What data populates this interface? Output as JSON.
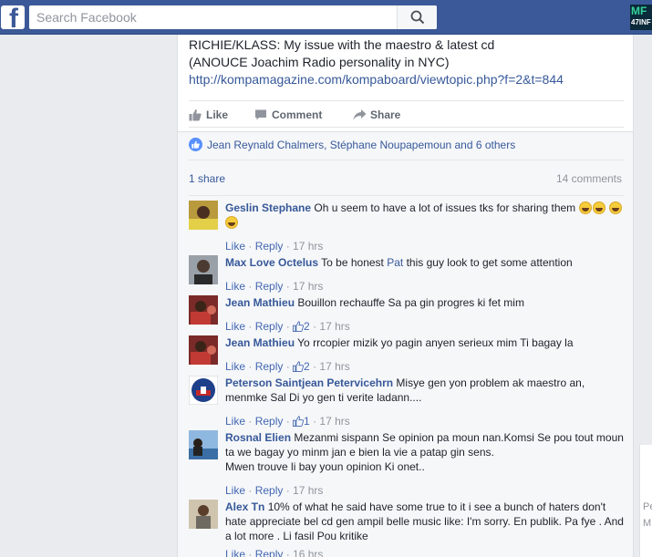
{
  "topbar": {
    "logo_letter": "f",
    "search_placeholder": "Search Facebook",
    "corner_logo_line1": "MF",
    "corner_logo_line2": "47INF"
  },
  "post": {
    "text_line1": "RICHIE/KLASS: My issue with the maestro & latest cd",
    "text_line2": "(ANOUCE Joachim Radio personality in NYC)",
    "link": "http://kompamagazine.com/kompaboard/viewtopic.php?f=2&t=844",
    "actions": {
      "like": "Like",
      "comment": "Comment",
      "share": "Share"
    },
    "likers": "Jean Reynald Chalmers, Stéphane Noupapemoun and 6 others",
    "shares": "1 share",
    "comment_count": "14 comments"
  },
  "comments": [
    {
      "author": "Geslin Stephane",
      "text": "Oh u seem to have a lot of issues tks for sharing them",
      "like": "Like",
      "reply": "Reply",
      "likes": "",
      "time": "17 hrs",
      "avatar_color": "#c9a74a"
    },
    {
      "author": "Max Love Octelus",
      "text_before": "To be honest ",
      "mention": "Pat",
      "text_after": " this guy look to get some attention",
      "like": "Like",
      "reply": "Reply",
      "likes": "",
      "time": "17 hrs",
      "avatar_color": "#8a8f99"
    },
    {
      "author": "Jean Mathieu",
      "text": "Bouillon rechauffe Sa pa gin progres ki fet mim",
      "like": "Like",
      "reply": "Reply",
      "likes": "2",
      "time": "17 hrs",
      "avatar_color": "#a8443a"
    },
    {
      "author": "Jean Mathieu",
      "text": "Yo rrcopier mizik yo pagin anyen serieux mim Ti bagay la",
      "like": "Like",
      "reply": "Reply",
      "likes": "2",
      "time": "17 hrs",
      "avatar_color": "#a8443a"
    },
    {
      "author": "Peterson Saintjean Petervicehrn",
      "text": "Misye gen yon problem ak maestro an, menmke Sal Di yo gen ti verite ladann....",
      "like": "Like",
      "reply": "Reply",
      "likes": "1",
      "time": "17 hrs",
      "avatar_color": "#1e3f8a"
    },
    {
      "author": "Rosnal Elien",
      "text": "Mezanmi sispann Se opinion pa moun nan.Komsi Se pou tout moun ta we bagay yo minm jan e bien la vie a patap gin sens.",
      "text2": "Mwen trouve li bay youn opinion Ki onet..",
      "like": "Like",
      "reply": "Reply",
      "likes": "",
      "time": "17 hrs",
      "avatar_color": "#5c86b5"
    },
    {
      "author": "Alex Tn",
      "text": "10% of what he said have some true to it i see a bunch of haters don't hate appreciate bel cd gen ampil belle music like: I'm sorry. En publik. Pa fye . And a lot more . Li fasil Pou kritike",
      "like": "Like",
      "reply": "Reply",
      "likes": "",
      "time": "16 hrs",
      "avatar_color": "#8c7a5c"
    }
  ],
  "right_strip": {
    "line1": "Pe",
    "line2": "M"
  }
}
